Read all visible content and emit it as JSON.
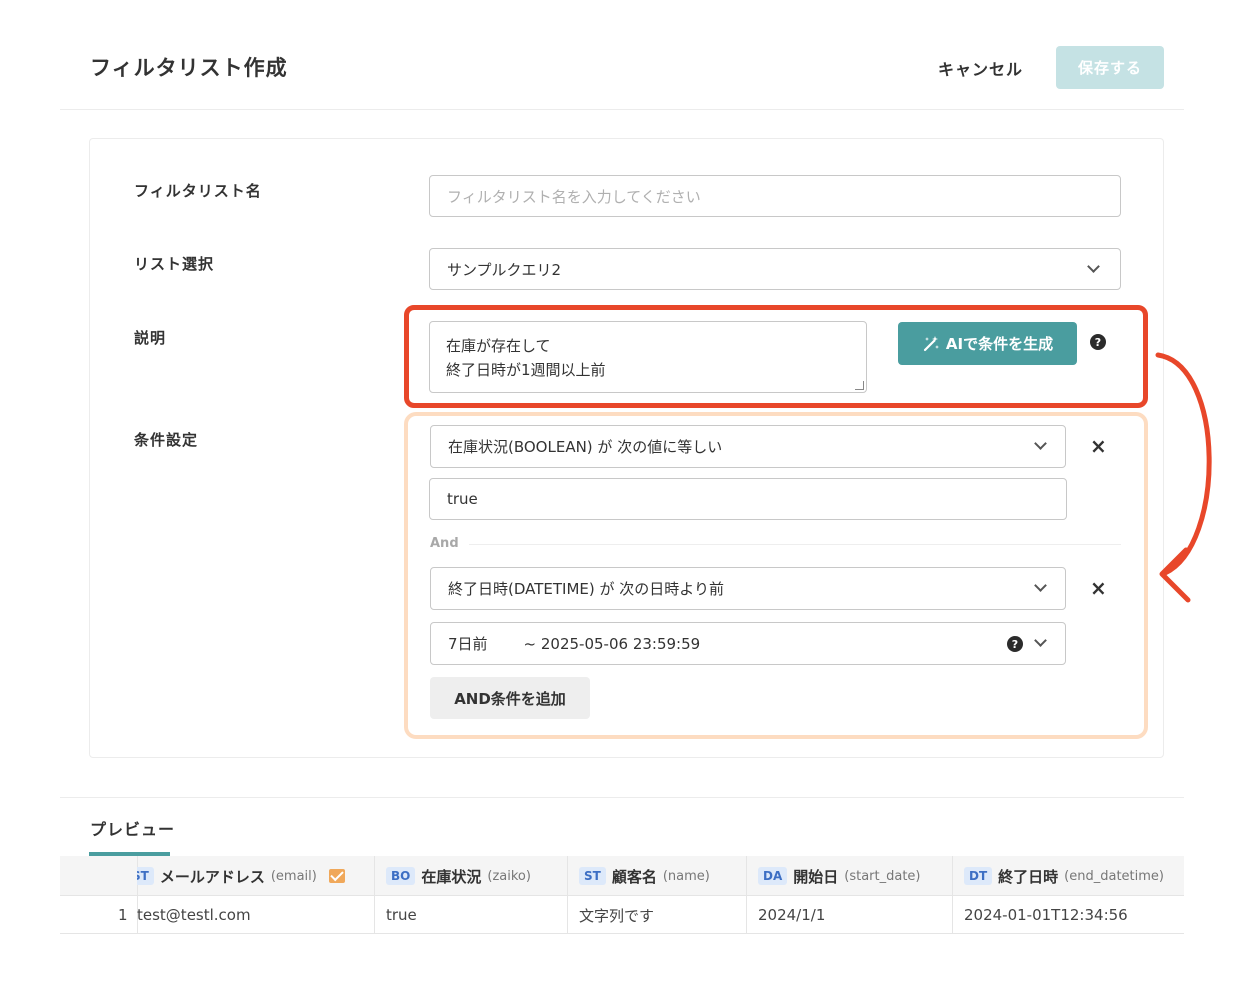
{
  "header": {
    "title": "フィルタリスト作成",
    "cancel_label": "キャンセル",
    "save_label": "保存する"
  },
  "form": {
    "name": {
      "label": "フィルタリスト名",
      "placeholder": "フィルタリスト名を入力してください"
    },
    "list": {
      "label": "リスト選択",
      "value": "サンプルクエリ2"
    },
    "description": {
      "label": "説明",
      "line1": "在庫が存在して",
      "line2": "終了日時が1週間以上前",
      "ai_button_label": "AIで条件を生成",
      "help": "?"
    },
    "conditions": {
      "label": "条件設定",
      "items": [
        {
          "field": "在庫状況(BOOLEAN) が 次の値に等しい",
          "value": "true"
        },
        {
          "field": "終了日時(DATETIME) が 次の日時より前",
          "value_relative": "7日前",
          "value_absolute": "~ 2025-05-06 23:59:59"
        }
      ],
      "connector": "And",
      "close_symbol": "×",
      "add_and_label": "AND条件を追加"
    }
  },
  "preview": {
    "tab_label": "プレビュー",
    "columns": [
      {
        "type": "ST",
        "name": "メールアドレス",
        "key": "(email)"
      },
      {
        "type": "BO",
        "name": "在庫状況",
        "key": "(zaiko)"
      },
      {
        "type": "ST",
        "name": "顧客名",
        "key": "(name)"
      },
      {
        "type": "DA",
        "name": "開始日",
        "key": "(start_date)"
      },
      {
        "type": "DT",
        "name": "終了日時",
        "key": "(end_datetime)"
      }
    ],
    "rows": [
      {
        "index": "1",
        "cells": [
          "test@testl.com",
          "true",
          "文字列です",
          "2024/1/1",
          "2024-01-01T12:34:56"
        ]
      }
    ]
  },
  "colors": {
    "accent": "#4a9d9f",
    "highlight_red": "#e8472a",
    "highlight_orange": "#fddcc1"
  }
}
